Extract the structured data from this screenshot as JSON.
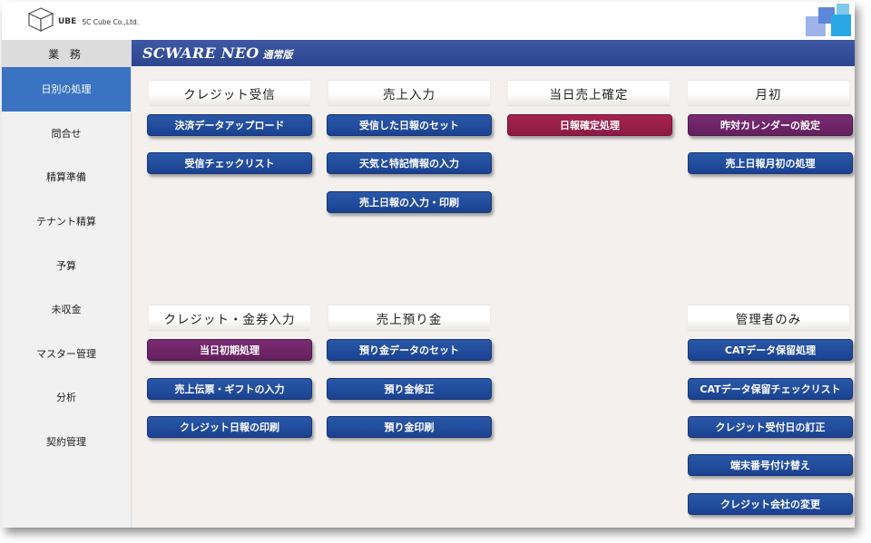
{
  "logo": {
    "word": "UBE",
    "company": "SC Cube Co.,Ltd."
  },
  "brand": {
    "name": "SCWARE NEO",
    "edition": "通常版"
  },
  "sidebar": {
    "header": "業 務",
    "items": [
      {
        "label": "日別の処理",
        "active": true
      },
      {
        "label": "問合せ"
      },
      {
        "label": "精算準備"
      },
      {
        "label": "テナント精算"
      },
      {
        "label": "予算"
      },
      {
        "label": "未収金"
      },
      {
        "label": "マスター管理"
      },
      {
        "label": "分析"
      },
      {
        "label": "契約管理"
      }
    ]
  },
  "sections": {
    "credit_receive": {
      "title": "クレジット受信",
      "buttons": [
        "決済データアップロード",
        "受信チェックリスト"
      ]
    },
    "sales_input": {
      "title": "売上入力",
      "buttons": [
        "受信した日報のセット",
        "天気と特記情報の入力",
        "売上日報の入力・印刷"
      ]
    },
    "daily_confirm": {
      "title": "当日売上確定",
      "buttons": [
        "日報確定処理"
      ]
    },
    "month_start": {
      "title": "月初",
      "buttons": [
        "昨対カレンダーの設定",
        "売上日報月初の処理"
      ]
    },
    "credit_voucher": {
      "title": "クレジット・金券入力",
      "buttons": [
        "当日初期処理",
        "売上伝票・ギフトの入力",
        "クレジット日報の印刷"
      ]
    },
    "sales_deposit": {
      "title": "売上預り金",
      "buttons": [
        "預り金データのセット",
        "預り金修正",
        "預り金印刷"
      ]
    },
    "admin_only": {
      "title": "管理者のみ",
      "buttons": [
        "CATデータ保留処理",
        "CATデータ保留チェックリスト",
        "クレジット受付日の訂正",
        "端末番号付け替え",
        "クレジット会社の変更"
      ]
    }
  },
  "colors": {
    "blue_button": "#1f4a9c",
    "purple_button": "#6c2466",
    "crimson_button": "#981e48",
    "header_bar": "#34509c",
    "active_nav": "#3a73c2"
  }
}
